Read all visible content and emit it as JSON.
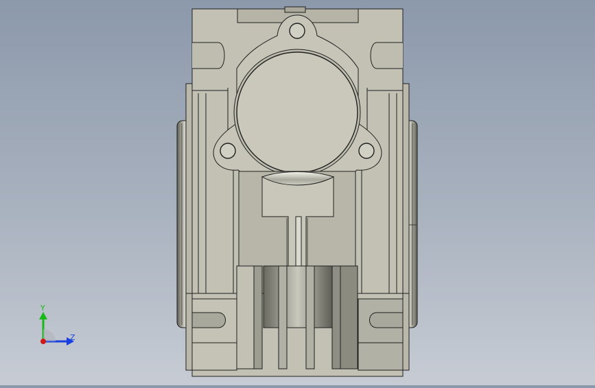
{
  "viewport": {
    "background_top": "#8c99ab",
    "background_bottom": "#c7ccd4",
    "model_fill": "#c2c1b4",
    "model_shadow": "#8e8d82",
    "edge_color": "#1f1f1f"
  },
  "triad": {
    "y_label": "Y",
    "z_label": "Z",
    "y_color": "#17b817",
    "z_color": "#1a3fe0",
    "x_color": "#d01818"
  }
}
